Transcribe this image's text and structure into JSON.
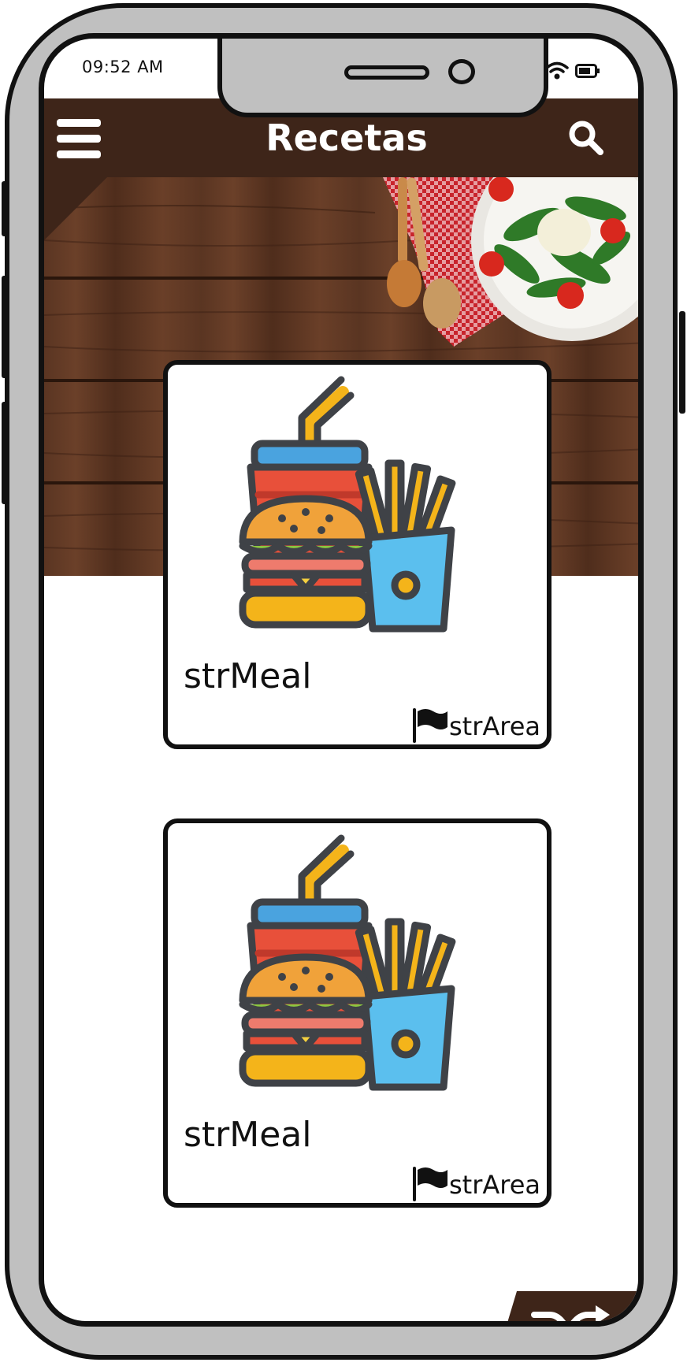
{
  "status_bar": {
    "time": "09:52 AM"
  },
  "header": {
    "title": "Recetas"
  },
  "icons": {
    "menu": "menu-icon",
    "search": "search-icon",
    "flag": "flag-icon",
    "shuffle": "shuffle-icon",
    "signal": "signal-icon",
    "wifi": "wifi-icon",
    "battery": "battery-icon"
  },
  "colors": {
    "brand": "#3e2519",
    "frame": "#c0c0c0"
  },
  "meals": [
    {
      "name": "strMeal",
      "area": "strArea"
    },
    {
      "name": "strMeal",
      "area": "strArea"
    }
  ]
}
